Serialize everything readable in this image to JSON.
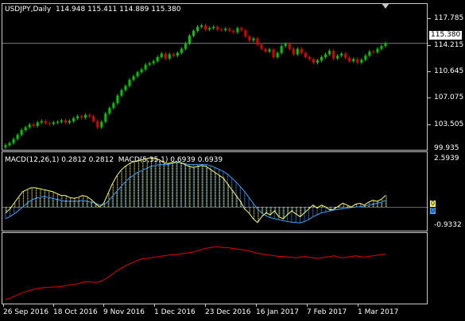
{
  "symbol": "USDJPY,Daily",
  "ohlc": [
    "114.948",
    "115.411",
    "114.889",
    "115.380"
  ],
  "price_scale": [
    "117.785",
    "114.215",
    "110.645",
    "107.075",
    "103.505",
    "99.935"
  ],
  "current_price": "115.380",
  "macd": {
    "label1": "MACD(12,26,1) 0.2812 0.2812",
    "label2": "MACD(5,35,1) 0.6939 0.6939",
    "scale_top": "2.5939",
    "scale_bottom": "-0.9332",
    "marker1": "0",
    "marker2": "0"
  },
  "dates": [
    "26 Sep 2016",
    "18 Oct 2016",
    "9 Nov 2016",
    "1 Dec 2016",
    "23 Dec 2016",
    "16 Jan 2017",
    "7 Feb 2017",
    "1 Mar 2017"
  ],
  "colors": {
    "bull": "#00c800",
    "bear": "#e00000",
    "macd_fast": "#ffff66",
    "macd_slow": "#3aa0ff",
    "line": "#e00000",
    "grid": "#c8c8c8"
  },
  "chart_data": {
    "type": "candlestick",
    "title": "USDJPY,Daily",
    "ylim": [
      99.935,
      119.5
    ],
    "closes": [
      100.6,
      100.9,
      101.5,
      102.1,
      102.8,
      103.2,
      103.6,
      103.4,
      103.9,
      104.1,
      103.8,
      103.7,
      103.9,
      104.0,
      104.2,
      103.9,
      104.1,
      104.5,
      104.8,
      104.6,
      105.0,
      104.8,
      104.1,
      103.2,
      104.0,
      105.2,
      106.0,
      106.7,
      107.8,
      108.6,
      109.2,
      110.1,
      110.6,
      111.2,
      111.6,
      112.3,
      112.5,
      112.8,
      113.4,
      113.9,
      113.2,
      113.8,
      113.6,
      114.0,
      114.6,
      115.4,
      116.5,
      117.2,
      117.8,
      118.0,
      117.4,
      117.6,
      117.8,
      117.4,
      117.3,
      117.5,
      117.2,
      117.0,
      117.6,
      117.3,
      116.4,
      115.8,
      116.1,
      115.2,
      114.6,
      114.2,
      114.5,
      113.4,
      114.0,
      115.0,
      115.3,
      114.6,
      113.8,
      114.6,
      114.0,
      113.4,
      113.1,
      112.6,
      112.9,
      113.4,
      113.8,
      114.3,
      113.2,
      113.6,
      113.9,
      113.3,
      112.8,
      113.1,
      112.6,
      113.0,
      113.6,
      114.2,
      114.1,
      114.6,
      115.0,
      115.38
    ],
    "macd_fast": [
      -0.3,
      -0.1,
      0.2,
      0.5,
      0.8,
      0.9,
      1.0,
      1.0,
      0.95,
      0.9,
      0.85,
      0.8,
      0.7,
      0.6,
      0.6,
      0.5,
      0.45,
      0.5,
      0.6,
      0.55,
      0.4,
      0.2,
      0.0,
      0.2,
      0.7,
      1.2,
      1.6,
      1.9,
      2.1,
      2.25,
      2.35,
      2.4,
      2.45,
      2.5,
      2.55,
      2.5,
      2.45,
      2.3,
      2.25,
      2.3,
      2.35,
      2.3,
      2.2,
      2.1,
      2.05,
      2.1,
      2.15,
      2.1,
      1.95,
      1.8,
      1.65,
      1.5,
      1.2,
      0.9,
      0.6,
      0.3,
      -0.1,
      -0.3,
      -0.6,
      -0.8,
      -0.5,
      -0.3,
      -0.4,
      -0.2,
      -0.5,
      -0.6,
      -0.4,
      -0.2,
      -0.35,
      -0.5,
      -0.3,
      -0.1,
      0.1,
      -0.05,
      0.1,
      0.0,
      -0.15,
      -0.1,
      0.05,
      0.2,
      0.1,
      0.0,
      0.15,
      0.2,
      0.1,
      0.25,
      0.35,
      0.3,
      0.4,
      0.6
    ],
    "macd_slow": [
      -0.6,
      -0.5,
      -0.35,
      -0.2,
      0.0,
      0.2,
      0.35,
      0.45,
      0.5,
      0.55,
      0.5,
      0.45,
      0.4,
      0.35,
      0.3,
      0.3,
      0.3,
      0.3,
      0.35,
      0.3,
      0.25,
      0.2,
      0.1,
      0.1,
      0.3,
      0.55,
      0.8,
      1.05,
      1.3,
      1.5,
      1.65,
      1.8,
      1.9,
      2.0,
      2.1,
      2.15,
      2.2,
      2.2,
      2.2,
      2.25,
      2.3,
      2.3,
      2.25,
      2.2,
      2.2,
      2.2,
      2.2,
      2.2,
      2.15,
      2.05,
      1.95,
      1.85,
      1.7,
      1.5,
      1.3,
      1.05,
      0.8,
      0.5,
      0.2,
      -0.1,
      -0.3,
      -0.45,
      -0.55,
      -0.6,
      -0.65,
      -0.7,
      -0.75,
      -0.78,
      -0.8,
      -0.82,
      -0.75,
      -0.65,
      -0.5,
      -0.4,
      -0.3,
      -0.25,
      -0.2,
      -0.15,
      -0.12,
      -0.08,
      -0.05,
      -0.02,
      0.0,
      0.02,
      0.05,
      0.1,
      0.15,
      0.2,
      0.25,
      0.35
    ],
    "line_values": [
      5,
      7,
      10,
      13,
      16,
      18,
      20,
      22,
      23,
      24,
      24,
      25,
      25,
      26,
      27,
      28,
      29,
      30,
      32,
      33,
      33,
      32,
      33,
      36,
      40,
      45,
      50,
      54,
      58,
      61,
      64,
      67,
      69,
      70,
      71,
      72,
      73,
      74,
      75,
      76,
      76,
      77,
      78,
      79,
      80,
      82,
      84,
      86,
      87,
      88,
      88,
      87,
      87,
      86,
      85,
      84,
      83,
      82,
      80,
      78,
      77,
      76,
      75,
      74,
      73,
      73,
      72,
      72,
      71,
      72,
      73,
      72,
      71,
      70,
      71,
      72,
      73,
      74,
      72,
      71,
      72,
      73,
      74,
      73,
      72,
      73,
      74,
      75,
      76,
      77
    ]
  }
}
